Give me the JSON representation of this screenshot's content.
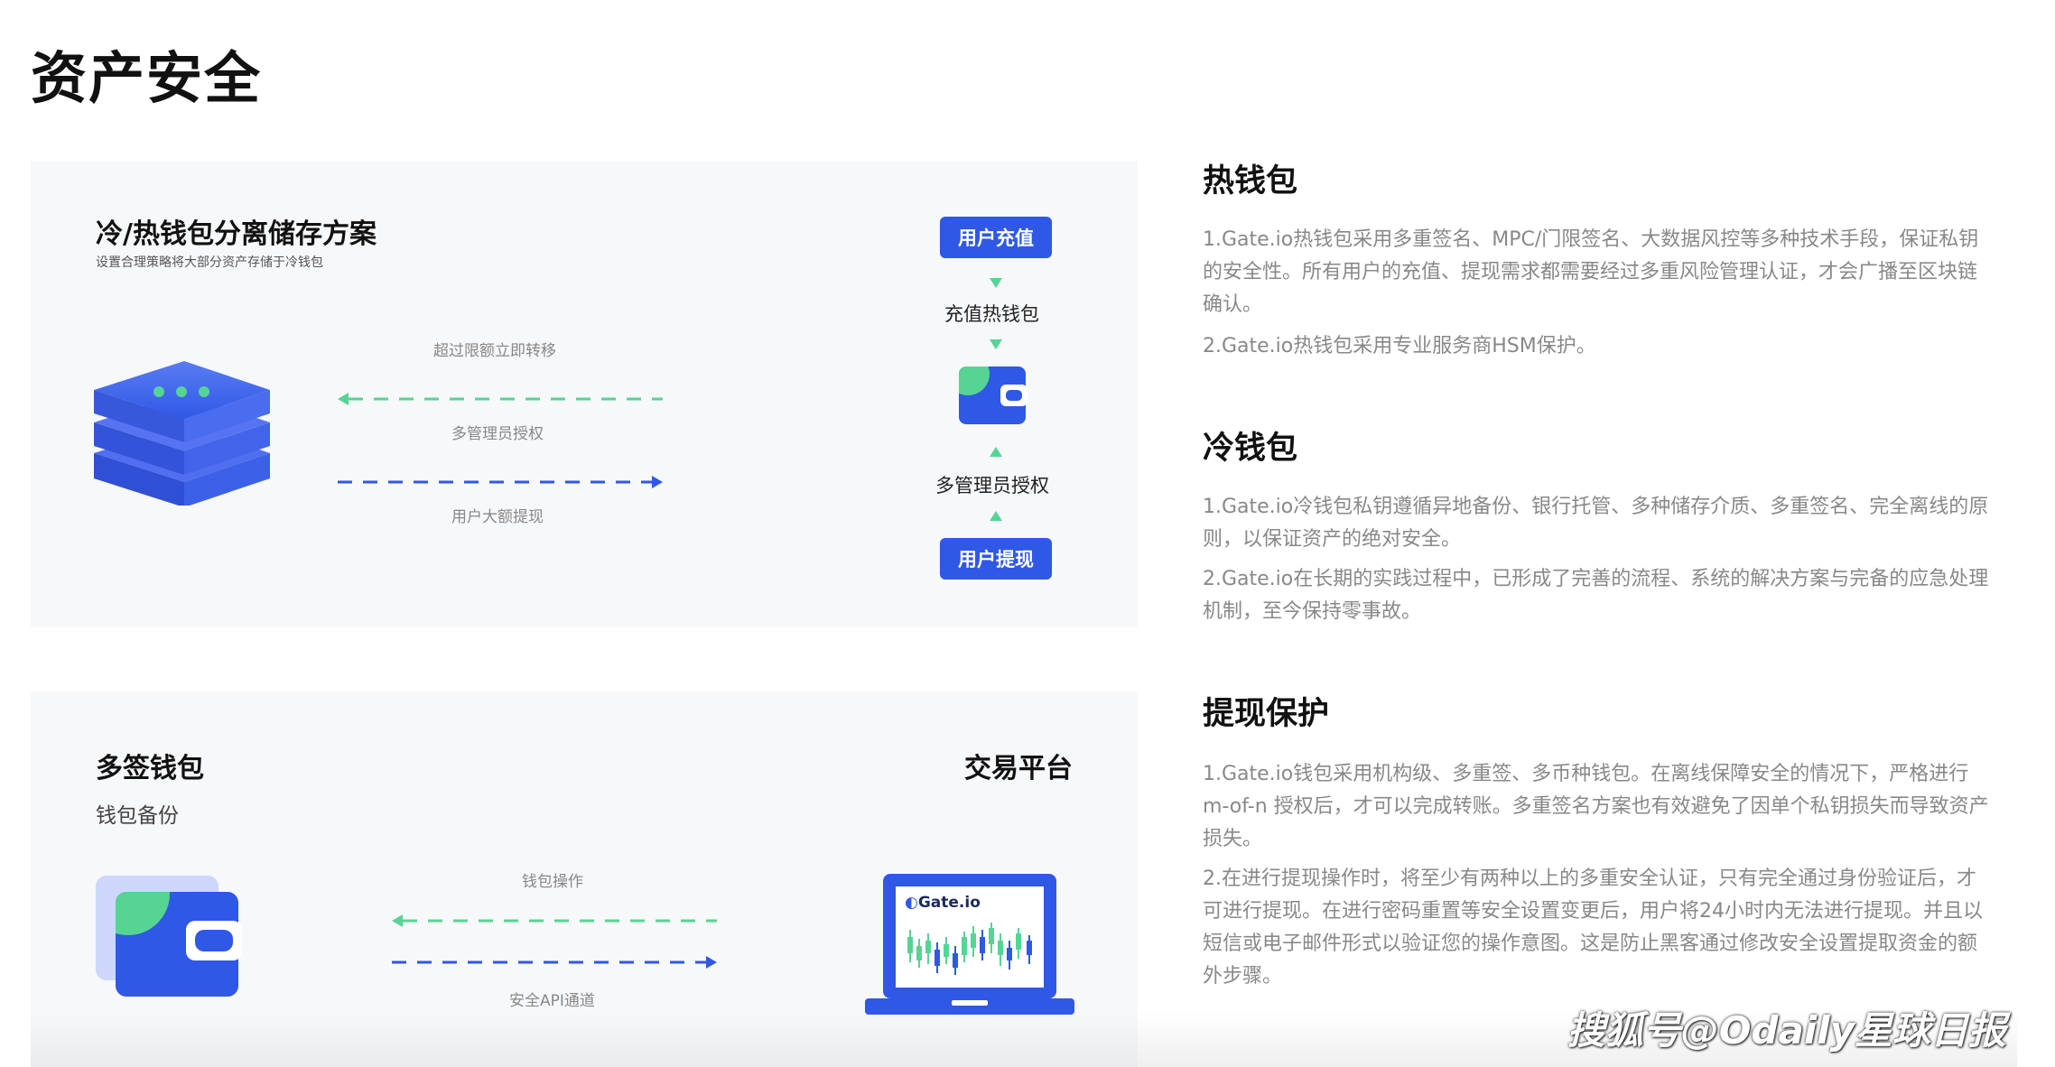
{
  "page": {
    "title": "资产安全"
  },
  "top_panel": {
    "title": "冷/热钱包分离储存方案",
    "subtitle": "设置合理策略将大部分资产存储于冷钱包",
    "arrow_label_top": "超过限额立即转移",
    "arrow_label_mid": "多管理员授权",
    "arrow_label_bottom": "用户大额提现",
    "deposit_button": "用户充值",
    "hot_wallet_label": "充值热钱包",
    "multi_admin_label": "多管理员授权",
    "withdraw_button": "用户提现"
  },
  "bottom_panel": {
    "title": "多签钱包",
    "subtitle": "钱包备份",
    "platform_title": "交易平台",
    "arrow_label_top": "钱包操作",
    "arrow_label_bottom": "安全API通道",
    "laptop_logo": "Gate.io"
  },
  "sections": [
    {
      "heading": "热钱包",
      "paragraphs": [
        "1.Gate.io热钱包采用多重签名、MPC/门限签名、大数据风控等多种技术手段，保证私钥的安全性。所有用户的充值、提现需求都需要经过多重风险管理认证，才会广播至区块链确认。",
        "2.Gate.io热钱包采用专业服务商HSM保护。"
      ]
    },
    {
      "heading": "冷钱包",
      "paragraphs": [
        "1.Gate.io冷钱包私钥遵循异地备份、银行托管、多种储存介质、多重签名、完全离线的原则，以保证资产的绝对安全。",
        "2.Gate.io在长期的实践过程中，已形成了完善的流程、系统的解决方案与完备的应急处理机制，至今保持零事故。"
      ]
    },
    {
      "heading": "提现保护",
      "paragraphs": [
        "1.Gate.io钱包采用机构级、多重签、多币种钱包。在离线保障安全的情况下，严格进行 m-of-n 授权后，才可以完成转账。多重签名方案也有效避免了因单个私钥损失而导致资产损失。",
        "2.在进行提现操作时，将至少有两种以上的多重安全认证，只有完全通过身份验证后，才可进行提现。在进行密码重置等安全设置变更后，用户将24小时内无法进行提现。并且以短信或电子邮件形式以验证您的操作意图。这是防止黑客通过修改安全设置提取资金的额外步骤。"
      ]
    }
  ],
  "watermark": "搜狐号@Odaily星球日报",
  "colors": {
    "brand_blue": "#2f58e6",
    "accent_green": "#56d494",
    "panel_bg": "#f7f8fa"
  },
  "icons": [
    "server-stack-icon",
    "wallet-icon",
    "laptop-chart-icon"
  ]
}
